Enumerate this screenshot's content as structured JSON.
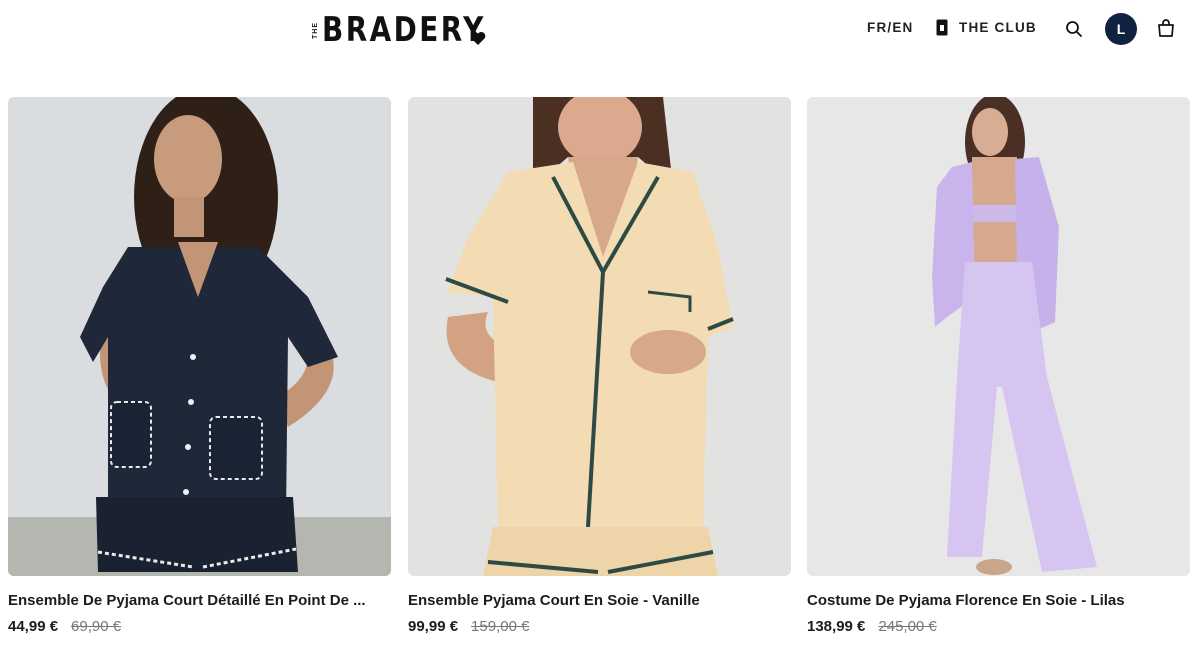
{
  "brand": {
    "prefix": "THE",
    "name": "BRADERY"
  },
  "nav": {
    "language": "FR/EN",
    "club_label": "THE CLUB",
    "avatar_initial": "L",
    "icons": [
      "search-icon",
      "shopping-bag-icon",
      "club-card-icon"
    ]
  },
  "colors": {
    "avatar_bg": "#0f2340",
    "text": "#1c1c1c",
    "old_price": "#777777"
  },
  "products": [
    {
      "title": "Ensemble De Pyjama Court Détaillé En Point De ...",
      "price": "44,99 €",
      "old_price": "69,90 €",
      "image": "model in navy short pyjama set with white stitched pockets"
    },
    {
      "title": "Ensemble Pyjama Court En Soie - Vanille",
      "price": "99,99 €",
      "old_price": "159,00 €",
      "image": "model in vanilla silk short pyjama with green piping"
    },
    {
      "title": "Costume De Pyjama Florence En Soie - Lilas",
      "price": "138,99 €",
      "old_price": "245,00 €",
      "image": "model in lilac silk pyjama suit"
    }
  ]
}
